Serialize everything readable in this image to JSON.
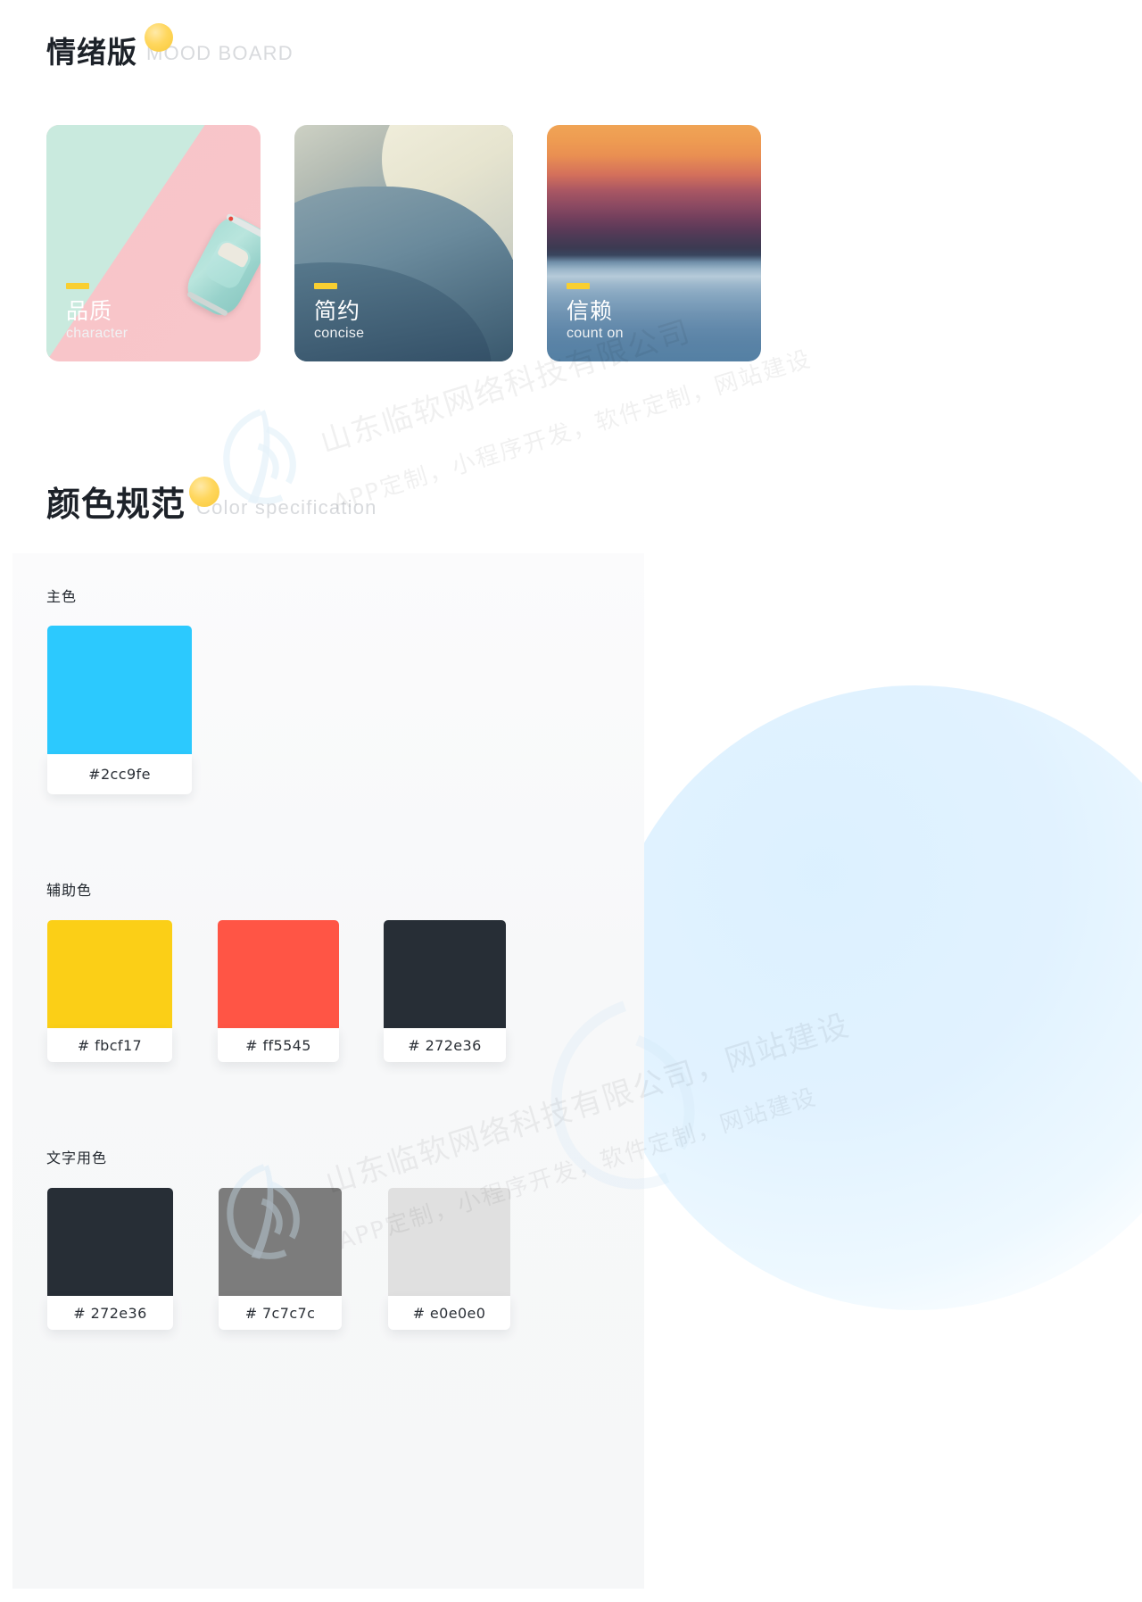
{
  "mood_section": {
    "title_cn": "情绪版",
    "title_en": "MOOD BOARD",
    "cards": [
      {
        "cn": "品质",
        "en": "character",
        "image": "pastel-toy-car-photo"
      },
      {
        "cn": "简约",
        "en": "concise",
        "image": "abstract-soft-curves-photo"
      },
      {
        "cn": "信赖",
        "en": "count on",
        "image": "sunset-over-sea-photo"
      }
    ]
  },
  "color_section": {
    "title_cn": "颜色规范",
    "title_en": "Color specification",
    "groups": [
      {
        "label": "主色",
        "swatches": [
          {
            "hex_label": "#2cc9fe",
            "color": "#2cc9fe"
          }
        ]
      },
      {
        "label": "辅助色",
        "swatches": [
          {
            "hex_label": "# fbcf17",
            "color": "#fbcf17"
          },
          {
            "hex_label": "# ff5545",
            "color": "#ff5545"
          },
          {
            "hex_label": "# 272e36",
            "color": "#272e36"
          }
        ]
      },
      {
        "label": "文字用色",
        "swatches": [
          {
            "hex_label": "# 272e36",
            "color": "#272e36"
          },
          {
            "hex_label": "# 7c7c7c",
            "color": "#7c7c7c"
          },
          {
            "hex_label": "# e0e0e0",
            "color": "#e0e0e0"
          }
        ]
      }
    ]
  },
  "accents": {
    "yellow_dot": "#f9cf31",
    "yellow_dash": "#f9cf31"
  },
  "watermarks": [
    {
      "text": "山东临软网络科技有限公司"
    },
    {
      "text": "APP定制，小程序开发，软件定制，网站建设"
    },
    {
      "text": "山东临软网络科技有限公司，网站建设"
    },
    {
      "text": "APP定制，小程序开发，软件定制，网站建设"
    }
  ]
}
